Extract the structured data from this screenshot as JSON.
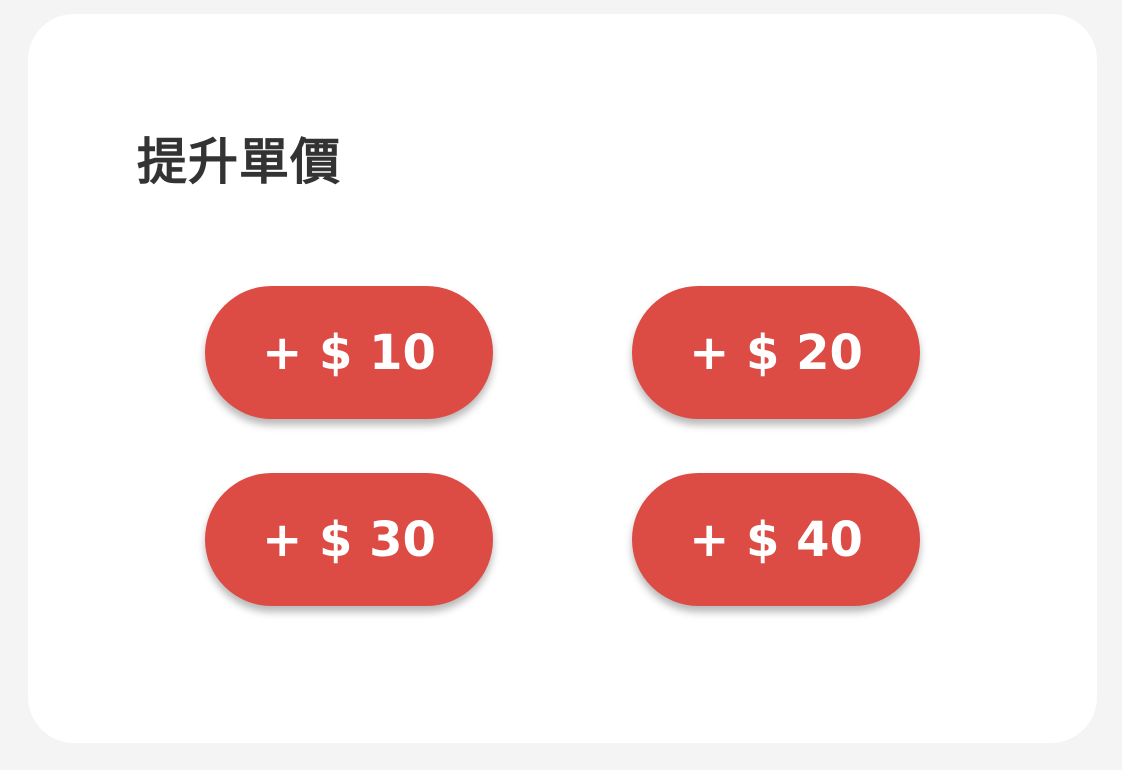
{
  "panel": {
    "title": "提升單價",
    "accent_color": "#dc4b44",
    "buttons": [
      {
        "label": "+ $ 10"
      },
      {
        "label": "+ $ 20"
      },
      {
        "label": "+ $ 30"
      },
      {
        "label": "+ $ 40"
      }
    ]
  }
}
